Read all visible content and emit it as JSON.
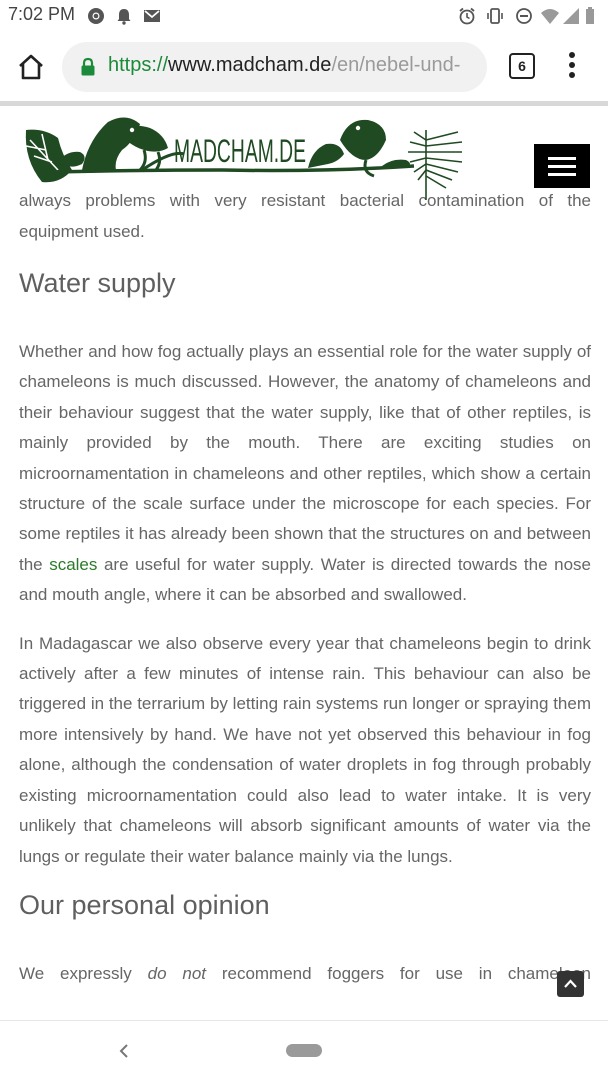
{
  "status_bar": {
    "time": "7:02 PM",
    "left_icons": [
      "chrome-icon",
      "notification-bell-icon",
      "gmail-icon"
    ],
    "right_icons": [
      "alarm-icon",
      "vibrate-icon",
      "do-not-disturb-icon",
      "wifi-icon",
      "signal-icon",
      "battery-icon"
    ]
  },
  "browser": {
    "url_scheme": "https://",
    "url_host": "www.madcham.de",
    "url_path": "/en/nebel-und-",
    "tab_count": "6"
  },
  "site": {
    "logo_text": "MADCHAM.DE"
  },
  "article": {
    "partial_line_top": "always problems with very resistant bacterial contamination of the",
    "partial_line_end": "equipment used.",
    "heading_water": "Water supply",
    "para1_a": "Whether and how fog actually plays an essential role for the water supply of chameleons is much discussed. However, the anatomy of chameleons and their behaviour suggest that the water supply, like that of other reptiles, is mainly provided by the mouth. There are exciting studies on microornamentation in chameleons and other reptiles, which show a certain structure of the scale surface under the microscope for each species. For some reptiles it has already been shown that the structures on and between the",
    "para1_link": "scales",
    "para1_b": "are useful for water supply. Water is directed towards the nose and mouth angle, where it can be absorbed and swallowed.",
    "para2": "In Madagascar we also observe every year that chameleons begin to drink actively after a few minutes of intense rain. This behaviour can also be triggered in the terrarium by letting rain systems run longer or spraying them more intensively by hand. We have not yet observed this behaviour in fog alone, although the condensation of water droplets in fog through probably existing microornamentation could also lead to water intake. It is very unlikely that chameleons will absorb significant amounts of water via the lungs or regulate their water balance mainly via the lungs.",
    "heading_opinion": "Our personal opinion",
    "para3_a": "We expressly",
    "para3_em": "do not",
    "para3_b": "recommend foggers for use in chameleon"
  },
  "colors": {
    "link": "#2a7a2a",
    "url_scheme": "#1b8a3a",
    "logo_green": "#1f4a22",
    "text": "#666666"
  }
}
